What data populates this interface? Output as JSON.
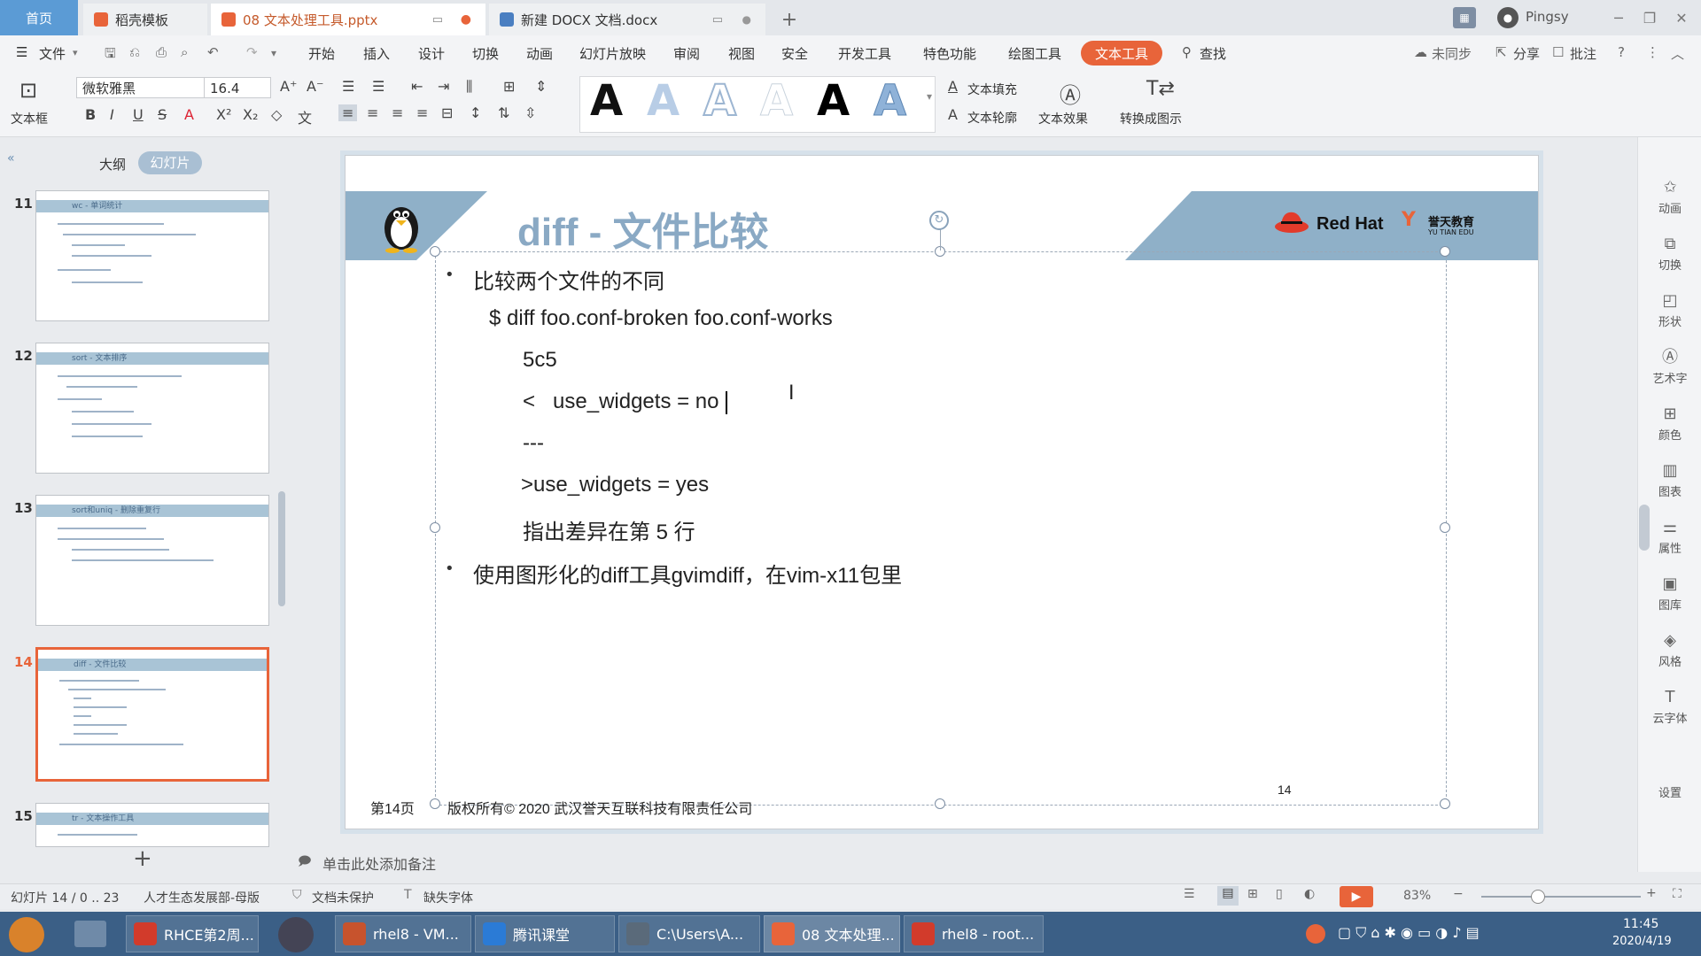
{
  "tabs": {
    "home": "首页",
    "t1": "稻壳模板",
    "t2": "08 文本处理工具.pptx",
    "t3": "新建 DOCX 文档.docx",
    "add": "+"
  },
  "user": "Pingsy",
  "menu": {
    "file": "文件",
    "items": [
      "开始",
      "插入",
      "设计",
      "切换",
      "动画",
      "幻灯片放映",
      "审阅",
      "视图",
      "安全",
      "开发工具",
      "特色功能",
      "绘图工具"
    ],
    "active": "文本工具",
    "search": "查找",
    "sync": "未同步",
    "share": "分享",
    "comment": "批注"
  },
  "ribbon": {
    "textbox": "文本框",
    "font": "微软雅黑",
    "size": "16.4",
    "fill": "文本填充",
    "outline": "文本轮廓",
    "effect": "文本效果",
    "convert": "转换成图示",
    "wordart_letter": "A"
  },
  "panel": {
    "outline_tab": "大纲",
    "slides_tab": "幻灯片",
    "thumbs": [
      {
        "num": "11",
        "title": "wc - 单词统计"
      },
      {
        "num": "12",
        "title": "sort - 文本排序"
      },
      {
        "num": "13",
        "title": "sort和uniq - 删除重复行"
      },
      {
        "num": "14",
        "title": "diff - 文件比较"
      },
      {
        "num": "15",
        "title": "tr - 文本操作工具"
      }
    ],
    "add": "+"
  },
  "slide": {
    "title": "diff - 文件比较",
    "brand": "Red Hat",
    "partner": "誉天教育",
    "partner_en": "YU TIAN EDU",
    "bullet1": "比较两个文件的不同",
    "cmd": "$ diff foo.conf-broken foo.conf-works",
    "line_5c5": "5c5",
    "line_lt": "<   use_widgets = no",
    "line_sep": "---",
    "line_gt": ">use_widgets = yes",
    "line_note": "指出差异在第 5 行",
    "bullet2": "使用图形化的diff工具gvimdiff，在vim-x11包里",
    "footer_page": "第14页",
    "footer_copy": "版权所有© 2020 武汉誉天互联科技有限责任公司",
    "footer_num": "14"
  },
  "notes_placeholder": "单击此处添加备注",
  "rightbar": [
    "动画",
    "切换",
    "形状",
    "艺术字",
    "颜色",
    "图表",
    "属性",
    "图库",
    "风格",
    "云字体",
    "设置"
  ],
  "status": {
    "slide": "幻灯片 14 / 0 .. 23",
    "template": "人才生态发展部-母版",
    "protect": "文档未保护",
    "missing": "缺失字体",
    "zoom": "83%"
  },
  "taskbar": {
    "items": [
      "RHCE第2周...",
      "rhel8 - VM...",
      "腾讯课堂",
      "C:\\Users\\A...",
      "08 文本处理...",
      "rhel8 - root..."
    ],
    "time": "11:45",
    "date": "2020/4/19"
  },
  "colors": {
    "accent": "#e8643a",
    "title": "#8aa9c4",
    "banner": "#8fb0c8",
    "taskbar": "#3b5f86"
  }
}
